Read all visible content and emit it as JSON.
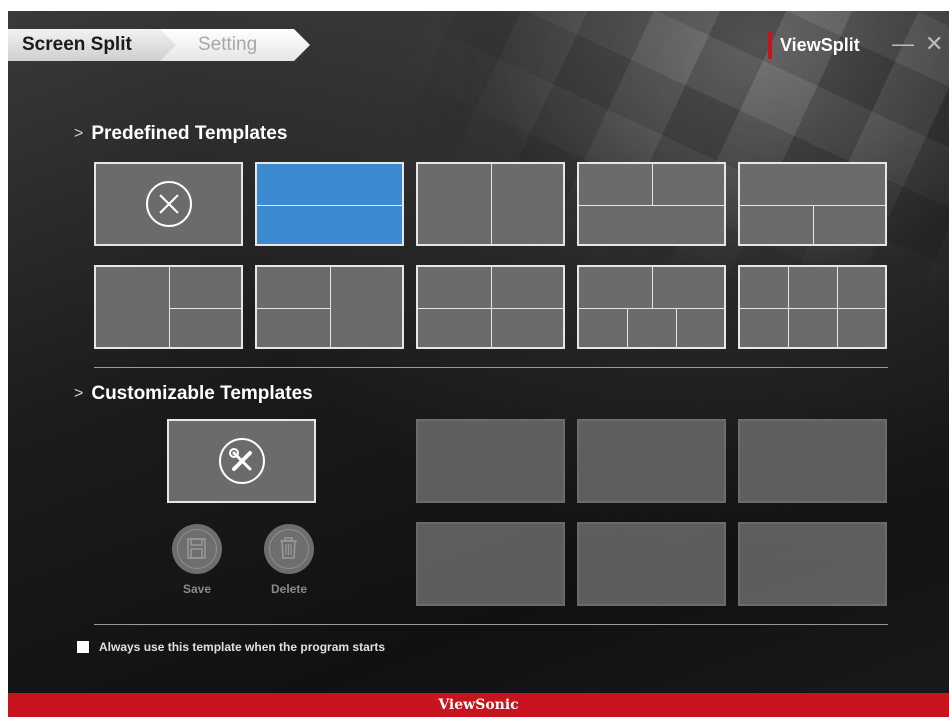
{
  "tabs": {
    "active": "Screen Split",
    "inactive": "Setting"
  },
  "brand": {
    "name": "ViewSplit",
    "accent": "#c8141e"
  },
  "window_controls": {
    "minimize": "—",
    "close": "✕"
  },
  "sections": {
    "predefined": "Predefined Templates",
    "customizable": "Customizable Templates"
  },
  "predefined_templates": [
    {
      "layout": "none"
    },
    {
      "layout": "2-horizontal",
      "selected": true
    },
    {
      "layout": "2-vertical"
    },
    {
      "layout": "2-top-1-bottom"
    },
    {
      "layout": "1-top-2-bottom"
    },
    {
      "layout": "1-left-2-right"
    },
    {
      "layout": "2-left-1-right"
    },
    {
      "layout": "2x2-grid"
    },
    {
      "layout": "2-top-3-bottom"
    },
    {
      "layout": "3x2-grid"
    }
  ],
  "custom": {
    "edit_icon": "tools-icon",
    "save_label": "Save",
    "delete_label": "Delete",
    "slots": 6
  },
  "startup_option": {
    "label": "Always use this template when the program starts",
    "checked": false
  },
  "footer": {
    "logo": "ViewSonic"
  },
  "colors": {
    "selected": "#3d8ad1",
    "tile": "#6b6b6b"
  }
}
